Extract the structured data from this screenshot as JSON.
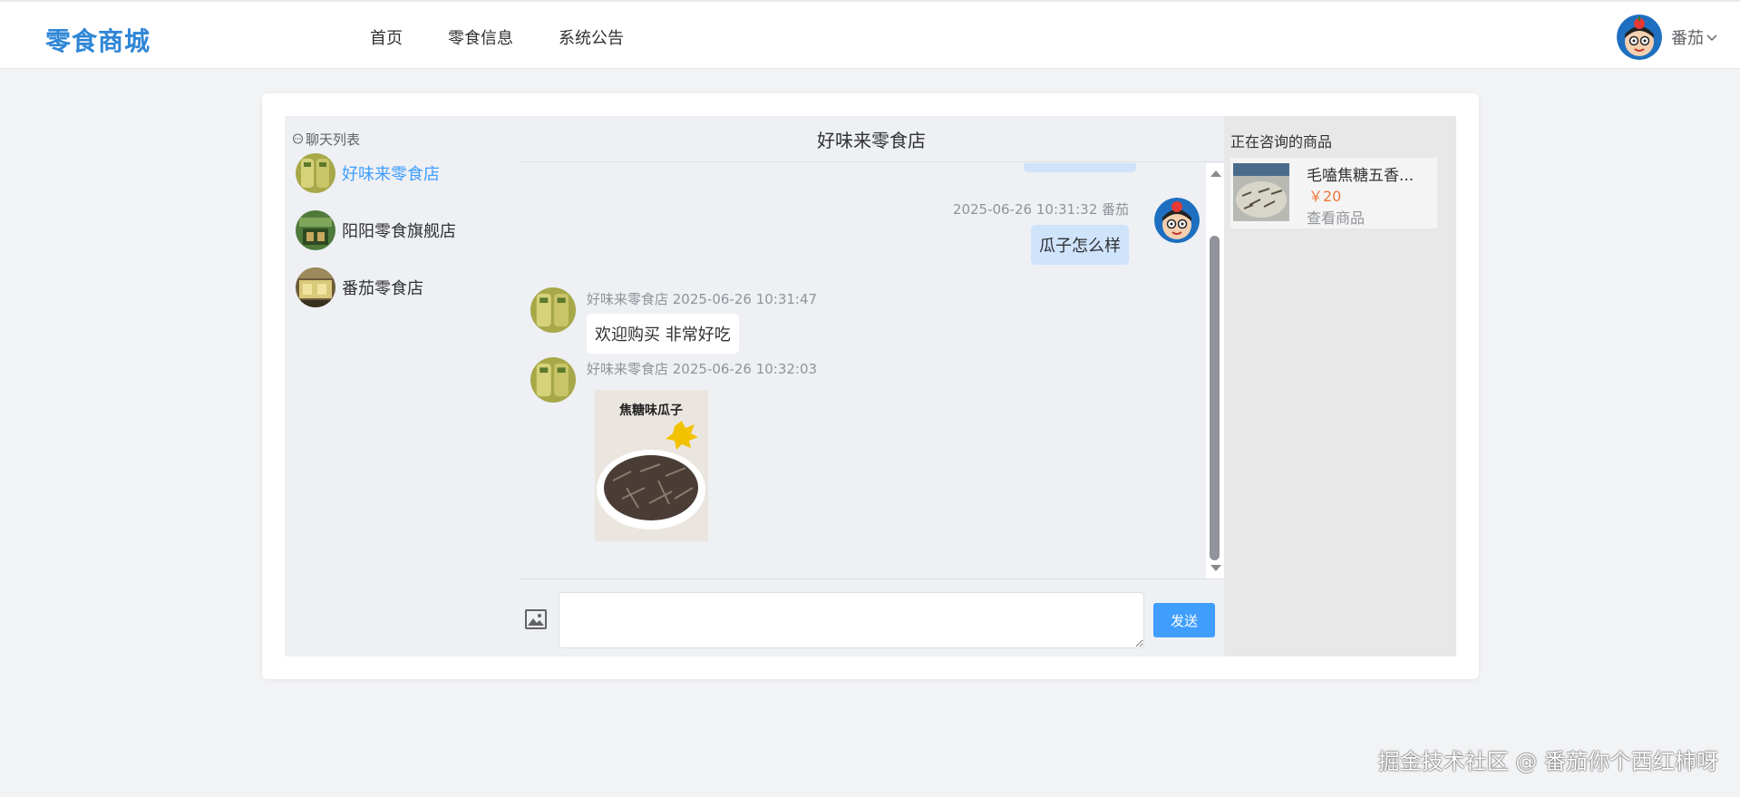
{
  "header": {
    "logo": "零食商城",
    "nav": [
      "首页",
      "零食信息",
      "系统公告"
    ],
    "user_name": "番茄"
  },
  "chat_list": {
    "title": "聊天列表",
    "shops": [
      {
        "name": "好味来零食店",
        "active": true
      },
      {
        "name": "阳阳零食旗舰店",
        "active": false
      },
      {
        "name": "番茄零食店",
        "active": false
      }
    ]
  },
  "conversation": {
    "title": "好味来零食店",
    "messages": [
      {
        "from": "me",
        "meta": "2025-06-26 10:31:32 番茄",
        "text": "瓜子怎么样"
      },
      {
        "from": "shop",
        "meta": "好味来零食店 2025-06-26 10:31:47",
        "text": "欢迎购买 非常好吃"
      },
      {
        "from": "shop",
        "meta": "好味来零食店 2025-06-26 10:32:03",
        "image_caption": "焦糖味瓜子"
      }
    ],
    "send_label": "发送"
  },
  "product_panel": {
    "title": "正在咨询的商品",
    "product_name": "毛嗑焦糖五香...",
    "price": "￥20",
    "view_label": "查看商品"
  },
  "watermark": "掘金技术社区 @ 番茄你个西红柿呀",
  "colors": {
    "brand": "#2f86d6",
    "accent": "#409eff",
    "price": "#f0783c",
    "my_bubble": "#cfe3fb"
  }
}
